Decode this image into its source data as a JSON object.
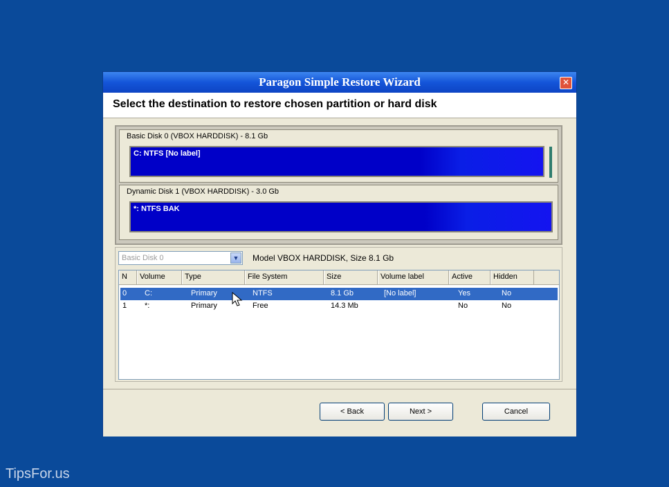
{
  "watermark": "TipsFor.us",
  "window": {
    "title": "Paragon Simple Restore Wizard",
    "heading": "Select the destination to restore chosen partition or hard disk"
  },
  "disks": [
    {
      "label": "Basic Disk 0 (VBOX HARDDISK) - 8.1 Gb",
      "partition": "C: NTFS [No label]"
    },
    {
      "label": "Dynamic Disk 1 (VBOX HARDDISK) - 3.0 Gb",
      "partition": "*: NTFS BAK"
    }
  ],
  "disk_select": {
    "value": "Basic Disk 0"
  },
  "model_info": "Model VBOX HARDDISK, Size 8.1 Gb",
  "table": {
    "columns": [
      "N",
      "Volume",
      "Type",
      "File System",
      "Size",
      "Volume label",
      "Active",
      "Hidden"
    ],
    "rows": [
      {
        "n": "0",
        "volume": "C:",
        "type": "Primary",
        "fs": "NTFS",
        "size": "8.1 Gb",
        "label": "[No label]",
        "active": "Yes",
        "hidden": "No"
      },
      {
        "n": "1",
        "volume": "*:",
        "type": "Primary",
        "fs": "Free",
        "size": "14.3 Mb",
        "label": "",
        "active": "No",
        "hidden": "No"
      }
    ]
  },
  "buttons": {
    "back": "< Back",
    "next": "Next >",
    "cancel": "Cancel"
  },
  "icons": {
    "close": "close-icon",
    "dropdown": "chevron-down-icon",
    "cursor": "mouse-pointer-icon"
  }
}
